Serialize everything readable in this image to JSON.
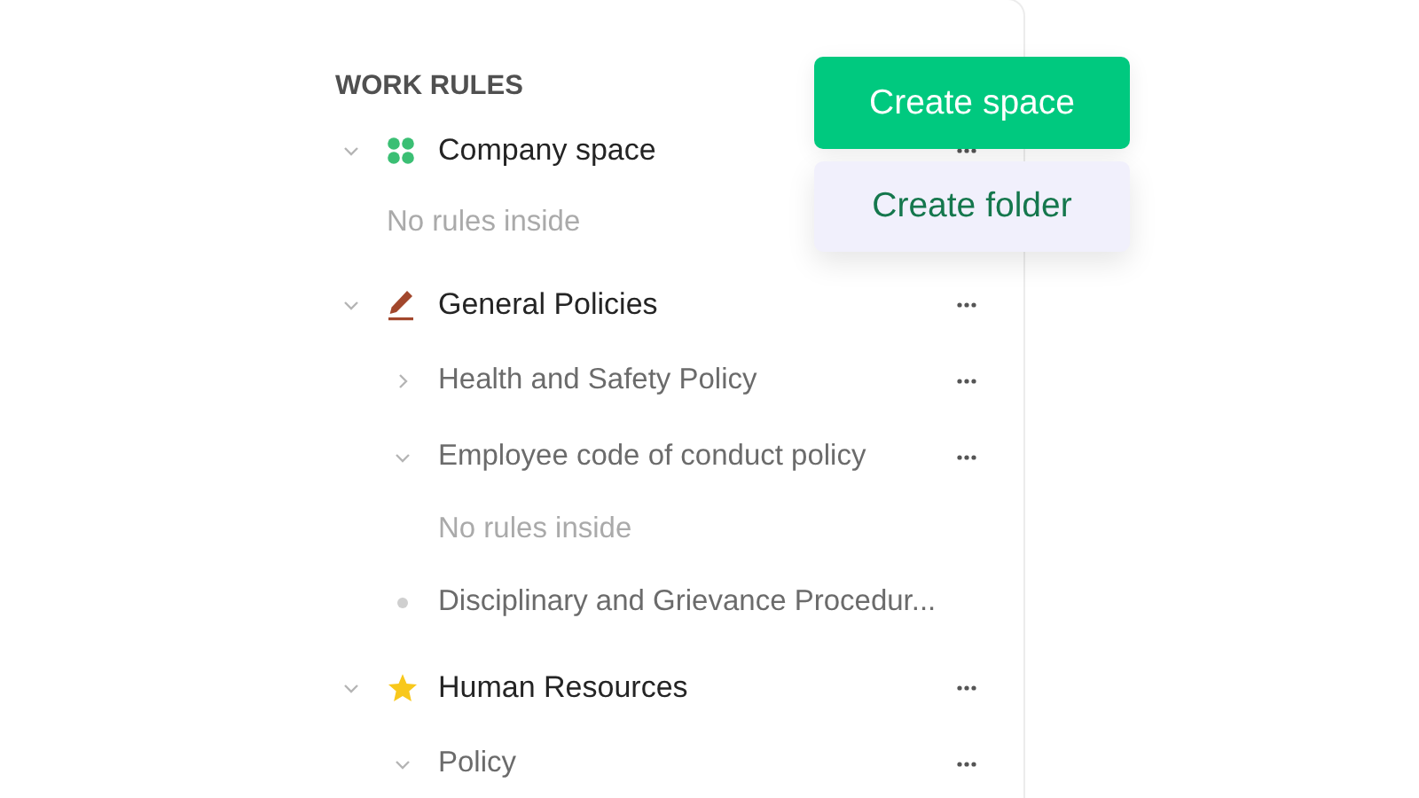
{
  "sidebar": {
    "heading": "WORK RULES",
    "spaces": [
      {
        "label": "Company space",
        "expanded": true,
        "children": [
          {
            "kind": "empty",
            "label": "No rules inside"
          }
        ]
      },
      {
        "label": "General Policies",
        "expanded": true,
        "children": [
          {
            "kind": "folder",
            "label": "Health and Safety Policy",
            "expanded": false
          },
          {
            "kind": "folder",
            "label": "Employee code of conduct policy",
            "expanded": true,
            "children": [
              {
                "kind": "empty",
                "label": "No rules inside"
              }
            ]
          },
          {
            "kind": "rule",
            "label": "Disciplinary and Grievance Procedur..."
          }
        ]
      },
      {
        "label": "Human Resources",
        "expanded": true,
        "children": [
          {
            "kind": "folder",
            "label": "Policy",
            "expanded": true
          }
        ]
      }
    ]
  },
  "menu": {
    "items": [
      {
        "label": "Create space",
        "kind": "primary"
      },
      {
        "label": "Create folder",
        "kind": "secondary"
      }
    ]
  }
}
